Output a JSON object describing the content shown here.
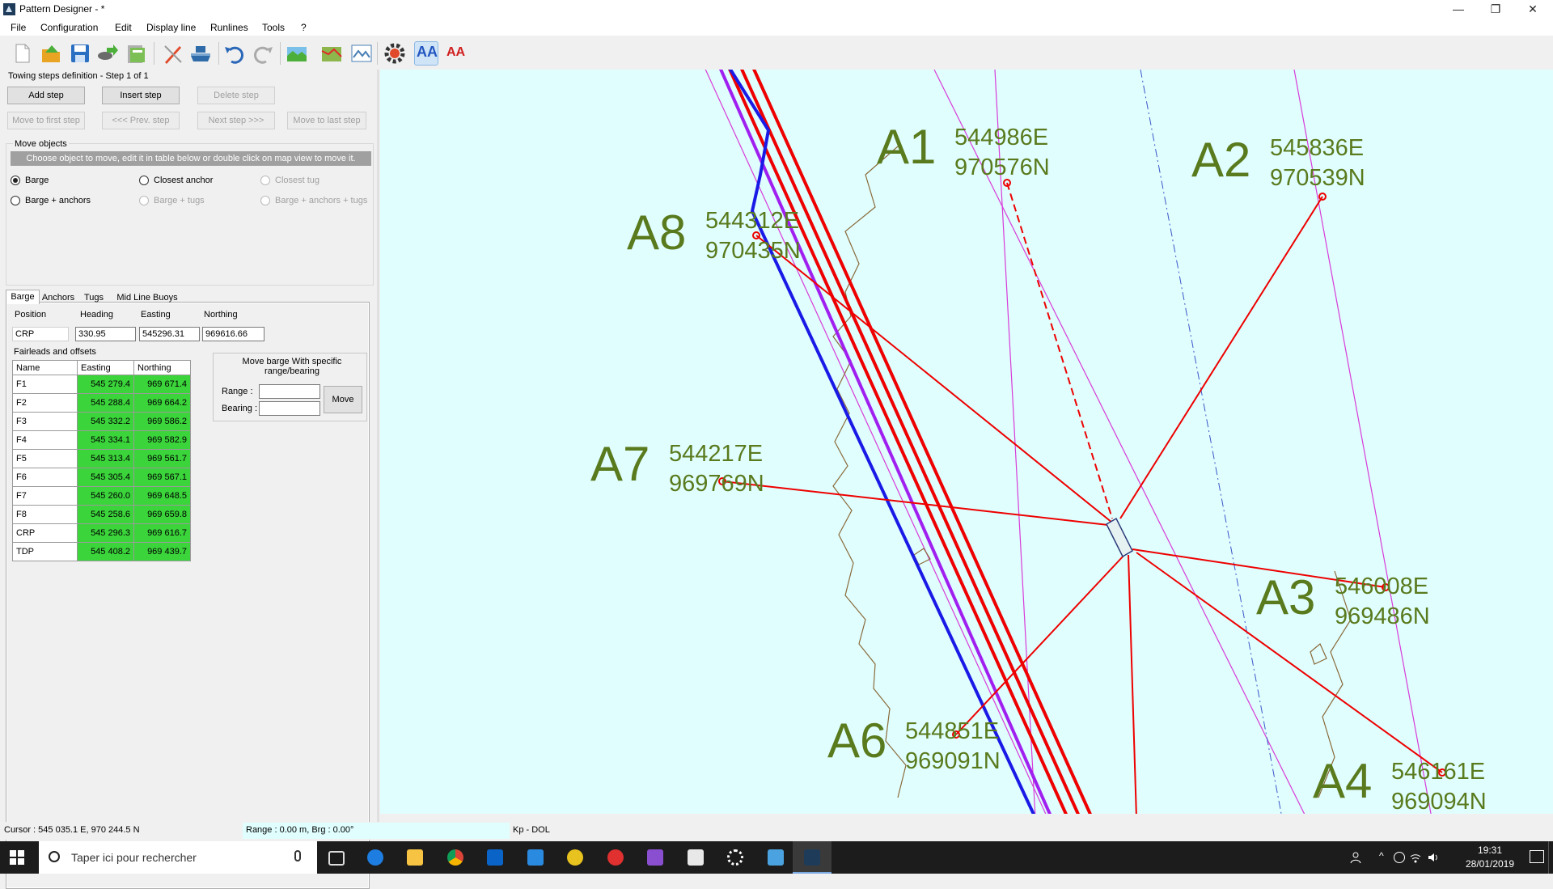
{
  "window": {
    "title": "Pattern Designer - *",
    "controls": {
      "minimize": "—",
      "maximize": "❐",
      "close": "✕"
    }
  },
  "menu": [
    "File",
    "Configuration",
    "Edit",
    "Display line",
    "Runlines",
    "Tools",
    "?"
  ],
  "toolbar": {
    "icons": [
      "new-file-icon",
      "open-folder-icon",
      "save-icon",
      "export-icon",
      "database-icon",
      "edit-pen-icon",
      "barge-icon",
      "undo-icon",
      "redo-icon",
      "map-import-icon",
      "chart-icon",
      "survey-map-icon",
      "settings-gear-icon",
      "font-large-icon",
      "font-small-icon"
    ],
    "font_large_label": "AA",
    "font_small_label": "AA"
  },
  "steps": {
    "header": "Towing steps definition - Step 1 of 1",
    "add": "Add step",
    "insert": "Insert step",
    "delete": "Delete step",
    "first": "Move to first step",
    "prev": "<<< Prev. step",
    "next": "Next step >>>",
    "last": "Move to last step"
  },
  "move_objects": {
    "title": "Move objects",
    "hint": "Choose object to move, edit it in table below or double click on map view to move it.",
    "options": {
      "barge": "Barge",
      "closest_anchor": "Closest anchor",
      "closest_tug": "Closest tug",
      "barge_anchors": "Barge + anchors",
      "barge_tugs": "Barge + tugs",
      "barge_anchors_tugs": "Barge + anchors + tugs"
    },
    "selected": "Barge"
  },
  "tabs": [
    "Barge",
    "Anchors",
    "Tugs",
    "Mid Line Buoys"
  ],
  "barge": {
    "headers": {
      "position": "Position",
      "heading": "Heading",
      "easting": "Easting",
      "northing": "Northing"
    },
    "position": "CRP",
    "heading": "330.95",
    "easting": "545296.31",
    "northing": "969616.66",
    "fairleads_title": "Fairleads and offsets",
    "table_headers": [
      "Name",
      "Easting",
      "Northing"
    ],
    "fairleads": [
      {
        "name": "F1",
        "easting": "545 279.4",
        "northing": "969 671.4"
      },
      {
        "name": "F2",
        "easting": "545 288.4",
        "northing": "969 664.2"
      },
      {
        "name": "F3",
        "easting": "545 332.2",
        "northing": "969 586.2"
      },
      {
        "name": "F4",
        "easting": "545 334.1",
        "northing": "969 582.9"
      },
      {
        "name": "F5",
        "easting": "545 313.4",
        "northing": "969 561.7"
      },
      {
        "name": "F6",
        "easting": "545 305.4",
        "northing": "969 567.1"
      },
      {
        "name": "F7",
        "easting": "545 260.0",
        "northing": "969 648.5"
      },
      {
        "name": "F8",
        "easting": "545 258.6",
        "northing": "969 659.8"
      },
      {
        "name": "CRP",
        "easting": "545 296.3",
        "northing": "969 616.7"
      },
      {
        "name": "TDP",
        "easting": "545 408.2",
        "northing": "969 439.7"
      }
    ],
    "move_box": {
      "title": "Move barge With specific range/bearing",
      "range_label": "Range :",
      "bearing_label": "Bearing :",
      "range_value": "",
      "bearing_value": "",
      "move": "Move"
    }
  },
  "map": {
    "background": "#e0fefe",
    "label_color": "#5a7a1e",
    "anchor_color": "#ee0000",
    "anchors": [
      {
        "id": "A1",
        "easting": "544986E",
        "northing": "970576N"
      },
      {
        "id": "A2",
        "easting": "545836E",
        "northing": "970539N"
      },
      {
        "id": "A3",
        "easting": "546008E",
        "northing": "969486N"
      },
      {
        "id": "A4",
        "easting": "546161E",
        "northing": "969094N"
      },
      {
        "id": "A6",
        "easting": "544851E",
        "northing": "969091N"
      },
      {
        "id": "A7",
        "easting": "544217E",
        "northing": "969769N"
      },
      {
        "id": "A8",
        "easting": "544312E",
        "northing": "970435N"
      }
    ]
  },
  "status": {
    "cursor": "Cursor : 545 035.1 E, 970 244.5 N",
    "range": "Range : 0.00 m, Brg : 0.00°",
    "kp": "Kp - DOL"
  },
  "taskbar": {
    "search_placeholder": "Taper ici pour rechercher",
    "time": "19:31",
    "date": "28/01/2019",
    "apps": [
      "task-view-icon",
      "edge-icon",
      "file-explorer-icon",
      "chrome-icon",
      "outlook-icon",
      "vscode-icon",
      "sunflower-app-icon",
      "red-app-icon",
      "visual-studio-icon",
      "photos-icon",
      "settings-icon",
      "remote-desktop-icon",
      "pattern-designer-icon"
    ]
  }
}
